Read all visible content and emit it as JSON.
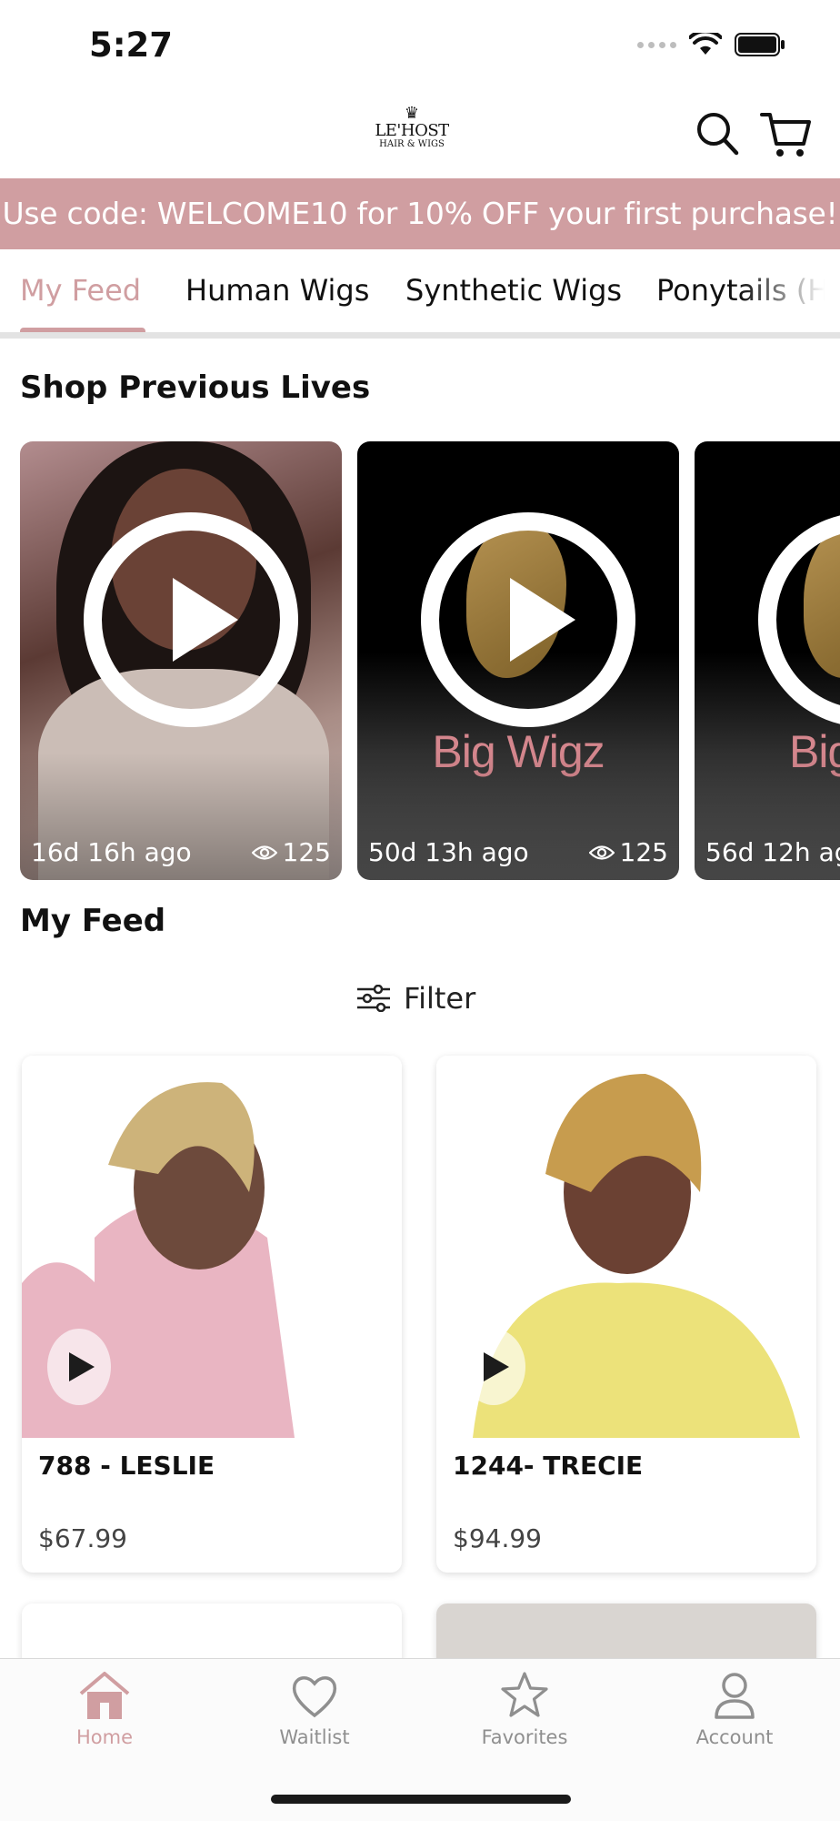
{
  "status_bar": {
    "time": "5:27"
  },
  "header": {
    "logo": {
      "ornament": "♛",
      "main": "LE'HOST",
      "sub": "HAIR & WIGS"
    }
  },
  "promo": {
    "text": "Use code: WELCOME10 for 10% OFF your first purchase!"
  },
  "tabs": [
    {
      "label": "My Feed",
      "active": true
    },
    {
      "label": "Human Wigs"
    },
    {
      "label": "Synthetic Wigs"
    },
    {
      "label": "Ponytails (H"
    }
  ],
  "shop_previous_lives": {
    "title": "Shop Previous Lives",
    "items": [
      {
        "ago": "16d 16h ago",
        "views": "125"
      },
      {
        "ago": "50d 13h ago",
        "views": "125",
        "brand": "Big Wigz"
      },
      {
        "ago": "56d 12h ag",
        "brand": "Big"
      }
    ]
  },
  "feed": {
    "title": "My Feed",
    "filter_label": "Filter",
    "products": [
      {
        "name": "788 - LESLIE",
        "price": "$67.99"
      },
      {
        "name": "1244- TRECIE",
        "price": "$94.99"
      }
    ]
  },
  "bottom_nav": [
    {
      "label": "Home",
      "active": true
    },
    {
      "label": "Waitlist"
    },
    {
      "label": "Favorites"
    },
    {
      "label": "Account"
    }
  ],
  "colors": {
    "accent": "#d09ea1",
    "brand_text": "#d4868d"
  }
}
